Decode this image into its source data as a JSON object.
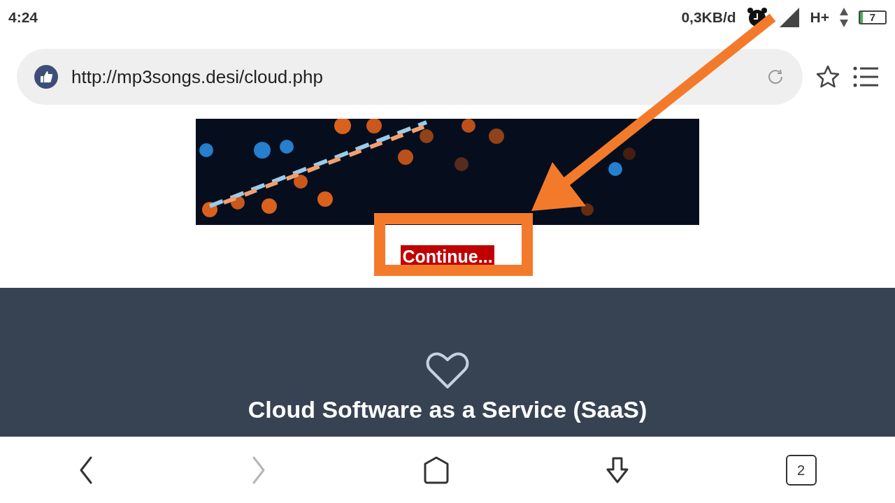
{
  "status_bar": {
    "time": "4:24",
    "network_speed": "0,3KB/d",
    "network_type": "H+",
    "battery": "7"
  },
  "address_bar": {
    "url": "http://mp3songs.desi/cloud.php"
  },
  "page": {
    "continue_link": "Continue...",
    "heading": "Cloud Software as a Service (SaaS)"
  },
  "bottom_nav": [
    {
      "kind": "back",
      "disabled": false
    },
    {
      "kind": "forward",
      "disabled": true
    },
    {
      "kind": "home",
      "disabled": false
    },
    {
      "kind": "download",
      "disabled": false
    },
    {
      "kind": "tabs",
      "count": "2",
      "disabled": false
    }
  ]
}
